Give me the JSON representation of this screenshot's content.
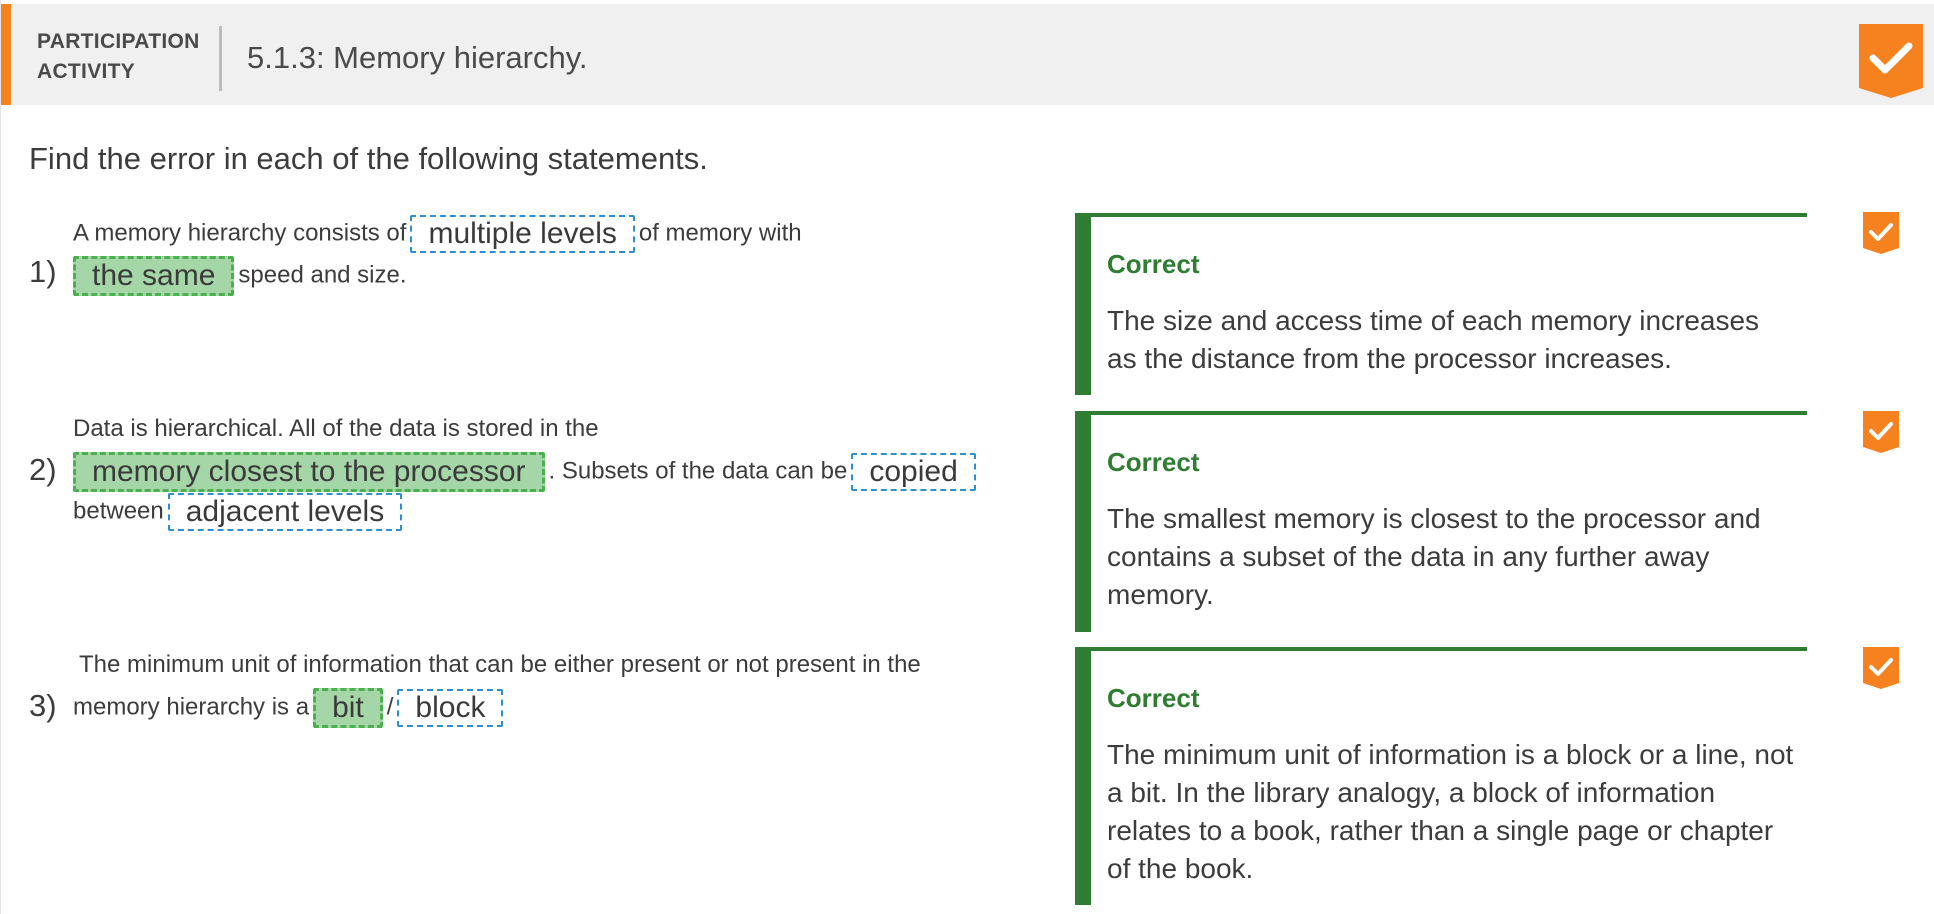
{
  "header": {
    "label": "PARTICIPATION\nACTIVITY",
    "title": "5.1.3: Memory hierarchy.",
    "completion_icon": "orange-check-badge-icon",
    "accent_color": "#f5821f"
  },
  "instructions": "Find the error in each of the following statements.",
  "questions": [
    {
      "number": "1)",
      "parts": {
        "t1": "A memory hierarchy consists of",
        "c1": "multiple levels",
        "t2": "of memory with",
        "c2": "the same",
        "t3": "speed and size."
      },
      "selected": "the same",
      "feedback": {
        "title": "Correct",
        "text": "The size and access time of each memory increases as the distance from the processor increases."
      }
    },
    {
      "number": "2)",
      "parts": {
        "t1": "Data is hierarchical. All of the data is stored in the",
        "c1": "memory closest to the processor",
        "t2": ". Subsets of the data can be",
        "c2": "copied",
        "t3": "between",
        "c3": "adjacent levels"
      },
      "selected": "memory closest to the processor",
      "feedback": {
        "title": "Correct",
        "text": "The smallest memory is closest to the processor and contains a subset of the data in any further away memory."
      }
    },
    {
      "number": "3)",
      "parts": {
        "t1": "The minimum unit of information that can be either present or not present in the",
        "t2": "memory hierarchy is a",
        "c1": "bit",
        "sep": "/",
        "c2": "block"
      },
      "selected": "bit",
      "feedback": {
        "title": "Correct",
        "text": "The minimum unit of information is a block or a line, not a bit. In the library analogy, a block of information relates to a book, rather than a single page or chapter of the book."
      }
    }
  ],
  "colors": {
    "correct_green": "#2e7d32",
    "selected_chip": "#a5d6a7",
    "chip_border": "#2e8fd0",
    "check_orange": "#f5821f"
  }
}
